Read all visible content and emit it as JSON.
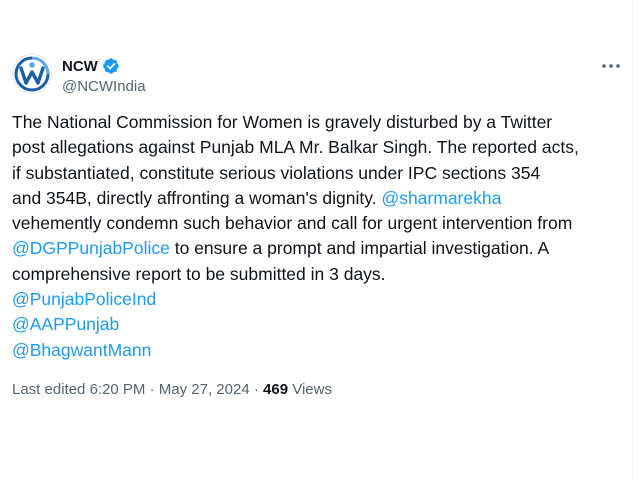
{
  "author": {
    "display_name": "NCW",
    "handle": "@NCWIndia",
    "verified": true,
    "avatar_icon": "ncw-logo-icon"
  },
  "tweet": {
    "lines": [
      "The National Commission for Women is gravely disturbed by a Twitter",
      "post allegations against Punjab MLA Mr. Balkar Singh. The reported acts,",
      "if substantiated, constitute serious violations under IPC sections 354",
      "and 354B, directly affronting a woman's dignity. "
    ],
    "mention_sharmarekha": "@sharmarekha",
    "line5": "vehemently condemn such behavior and call for urgent intervention from",
    "mention_dgp": "@DGPPunjabPolice",
    "line6_rest": " to ensure a prompt and impartial investigation. A",
    "line7": "comprehensive report to be submitted in 3 days.",
    "mention_police": "@PunjabPoliceInd",
    "mention_aap": "@AAPPunjab",
    "mention_bhagwant": "@BhagwantMann"
  },
  "meta": {
    "edited_label": "Last edited",
    "time": "6:20 PM",
    "separator": "·",
    "date": "May 27, 2024",
    "views_count": "469",
    "views_label": "Views"
  },
  "colors": {
    "link": "#1d9bf0",
    "text": "#0f1419",
    "secondary": "#536471"
  }
}
